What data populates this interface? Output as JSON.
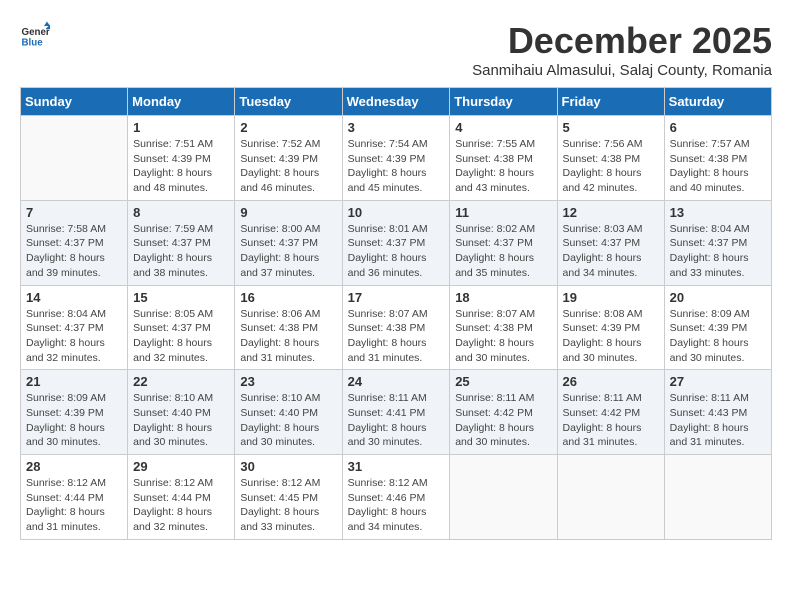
{
  "header": {
    "logo_general": "General",
    "logo_blue": "Blue",
    "title": "December 2025",
    "subtitle": "Sanmihaiu Almasului, Salaj County, Romania"
  },
  "weekdays": [
    "Sunday",
    "Monday",
    "Tuesday",
    "Wednesday",
    "Thursday",
    "Friday",
    "Saturday"
  ],
  "weeks": [
    [
      {
        "day": "",
        "info": ""
      },
      {
        "day": "1",
        "info": "Sunrise: 7:51 AM\nSunset: 4:39 PM\nDaylight: 8 hours\nand 48 minutes."
      },
      {
        "day": "2",
        "info": "Sunrise: 7:52 AM\nSunset: 4:39 PM\nDaylight: 8 hours\nand 46 minutes."
      },
      {
        "day": "3",
        "info": "Sunrise: 7:54 AM\nSunset: 4:39 PM\nDaylight: 8 hours\nand 45 minutes."
      },
      {
        "day": "4",
        "info": "Sunrise: 7:55 AM\nSunset: 4:38 PM\nDaylight: 8 hours\nand 43 minutes."
      },
      {
        "day": "5",
        "info": "Sunrise: 7:56 AM\nSunset: 4:38 PM\nDaylight: 8 hours\nand 42 minutes."
      },
      {
        "day": "6",
        "info": "Sunrise: 7:57 AM\nSunset: 4:38 PM\nDaylight: 8 hours\nand 40 minutes."
      }
    ],
    [
      {
        "day": "7",
        "info": "Sunrise: 7:58 AM\nSunset: 4:37 PM\nDaylight: 8 hours\nand 39 minutes."
      },
      {
        "day": "8",
        "info": "Sunrise: 7:59 AM\nSunset: 4:37 PM\nDaylight: 8 hours\nand 38 minutes."
      },
      {
        "day": "9",
        "info": "Sunrise: 8:00 AM\nSunset: 4:37 PM\nDaylight: 8 hours\nand 37 minutes."
      },
      {
        "day": "10",
        "info": "Sunrise: 8:01 AM\nSunset: 4:37 PM\nDaylight: 8 hours\nand 36 minutes."
      },
      {
        "day": "11",
        "info": "Sunrise: 8:02 AM\nSunset: 4:37 PM\nDaylight: 8 hours\nand 35 minutes."
      },
      {
        "day": "12",
        "info": "Sunrise: 8:03 AM\nSunset: 4:37 PM\nDaylight: 8 hours\nand 34 minutes."
      },
      {
        "day": "13",
        "info": "Sunrise: 8:04 AM\nSunset: 4:37 PM\nDaylight: 8 hours\nand 33 minutes."
      }
    ],
    [
      {
        "day": "14",
        "info": "Sunrise: 8:04 AM\nSunset: 4:37 PM\nDaylight: 8 hours\nand 32 minutes."
      },
      {
        "day": "15",
        "info": "Sunrise: 8:05 AM\nSunset: 4:37 PM\nDaylight: 8 hours\nand 32 minutes."
      },
      {
        "day": "16",
        "info": "Sunrise: 8:06 AM\nSunset: 4:38 PM\nDaylight: 8 hours\nand 31 minutes."
      },
      {
        "day": "17",
        "info": "Sunrise: 8:07 AM\nSunset: 4:38 PM\nDaylight: 8 hours\nand 31 minutes."
      },
      {
        "day": "18",
        "info": "Sunrise: 8:07 AM\nSunset: 4:38 PM\nDaylight: 8 hours\nand 30 minutes."
      },
      {
        "day": "19",
        "info": "Sunrise: 8:08 AM\nSunset: 4:39 PM\nDaylight: 8 hours\nand 30 minutes."
      },
      {
        "day": "20",
        "info": "Sunrise: 8:09 AM\nSunset: 4:39 PM\nDaylight: 8 hours\nand 30 minutes."
      }
    ],
    [
      {
        "day": "21",
        "info": "Sunrise: 8:09 AM\nSunset: 4:39 PM\nDaylight: 8 hours\nand 30 minutes."
      },
      {
        "day": "22",
        "info": "Sunrise: 8:10 AM\nSunset: 4:40 PM\nDaylight: 8 hours\nand 30 minutes."
      },
      {
        "day": "23",
        "info": "Sunrise: 8:10 AM\nSunset: 4:40 PM\nDaylight: 8 hours\nand 30 minutes."
      },
      {
        "day": "24",
        "info": "Sunrise: 8:11 AM\nSunset: 4:41 PM\nDaylight: 8 hours\nand 30 minutes."
      },
      {
        "day": "25",
        "info": "Sunrise: 8:11 AM\nSunset: 4:42 PM\nDaylight: 8 hours\nand 30 minutes."
      },
      {
        "day": "26",
        "info": "Sunrise: 8:11 AM\nSunset: 4:42 PM\nDaylight: 8 hours\nand 31 minutes."
      },
      {
        "day": "27",
        "info": "Sunrise: 8:11 AM\nSunset: 4:43 PM\nDaylight: 8 hours\nand 31 minutes."
      }
    ],
    [
      {
        "day": "28",
        "info": "Sunrise: 8:12 AM\nSunset: 4:44 PM\nDaylight: 8 hours\nand 31 minutes."
      },
      {
        "day": "29",
        "info": "Sunrise: 8:12 AM\nSunset: 4:44 PM\nDaylight: 8 hours\nand 32 minutes."
      },
      {
        "day": "30",
        "info": "Sunrise: 8:12 AM\nSunset: 4:45 PM\nDaylight: 8 hours\nand 33 minutes."
      },
      {
        "day": "31",
        "info": "Sunrise: 8:12 AM\nSunset: 4:46 PM\nDaylight: 8 hours\nand 34 minutes."
      },
      {
        "day": "",
        "info": ""
      },
      {
        "day": "",
        "info": ""
      },
      {
        "day": "",
        "info": ""
      }
    ]
  ]
}
